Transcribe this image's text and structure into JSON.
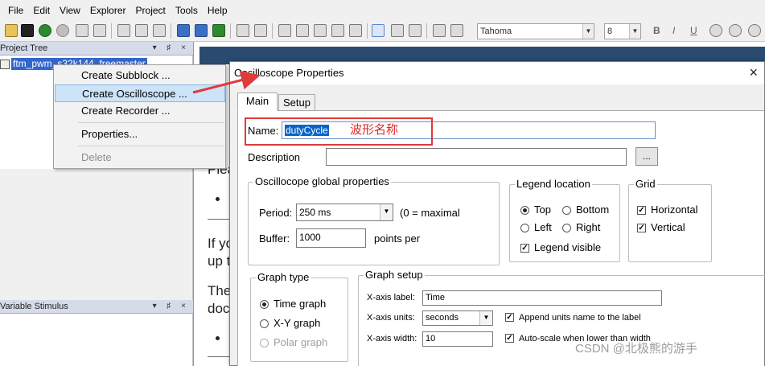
{
  "menubar": {
    "items": [
      "File",
      "Edit",
      "View",
      "Explorer",
      "Project",
      "Tools",
      "Help"
    ]
  },
  "toolbar": {
    "font_name": "Tahoma",
    "font_size": "8",
    "bold": "B",
    "italic": "I",
    "underline": "U"
  },
  "left_panels": {
    "project_tree_title": "Project Tree",
    "tree_node_label": "ftm_pwm_s32k144_freemaster",
    "variable_stimulus_title": "Variable Stimulus",
    "header_buttons": "▾ ♯ ×"
  },
  "context_menu": {
    "items": [
      "Create Subblock ...",
      "Create Oscilloscope ...",
      "Create Recorder ...",
      "Properties...",
      "Delete"
    ]
  },
  "background_doc": {
    "frag_1": "Plea",
    "frag_2": "If yo",
    "frag_3": "up t",
    "frag_4": "The",
    "frag_5": "doc"
  },
  "dialog": {
    "title": "Oscilloscope Properties",
    "close_glyph": "×",
    "tabs": [
      "Main",
      "Setup"
    ],
    "name_label": "Name:",
    "name_value": "dutyCycle",
    "name_annotation": "波形名称",
    "description_label": "Description",
    "description_value": "",
    "browse_button": "...",
    "global_group": "Oscillocope global properties",
    "period_label": "Period:",
    "period_value": "250 ms",
    "period_note": "(0 = maximal",
    "buffer_label": "Buffer:",
    "buffer_value": "1000",
    "buffer_note": "points per",
    "legend_group": "Legend location",
    "legend_top": "Top",
    "legend_bottom": "Bottom",
    "legend_left": "Left",
    "legend_right": "Right",
    "legend_visible": "Legend visible",
    "grid_group": "Grid",
    "grid_horizontal": "Horizontal",
    "grid_vertical": "Vertical",
    "graph_type_group": "Graph type",
    "graph_time": "Time graph",
    "graph_xy": "X-Y graph",
    "graph_polar": "Polar graph",
    "graph_setup_group": "Graph setup",
    "xaxis_label_label": "X-axis label:",
    "xaxis_label_value": "Time",
    "xaxis_units_label": "X-axis units:",
    "xaxis_units_value": "seconds",
    "append_units": "Append units name to the label",
    "xaxis_width_label": "X-axis width:",
    "xaxis_width_value": "10",
    "autoscale": "Auto-scale when lower than width"
  },
  "watermark": "CSDN @北极熊的游手",
  "annotation_color": "#e03a3a",
  "states": {
    "legend_location": "Top",
    "legend_visible": true,
    "grid_horizontal": true,
    "grid_vertical": true,
    "graph_type": "Time graph",
    "append_units": true,
    "autoscale": true
  }
}
